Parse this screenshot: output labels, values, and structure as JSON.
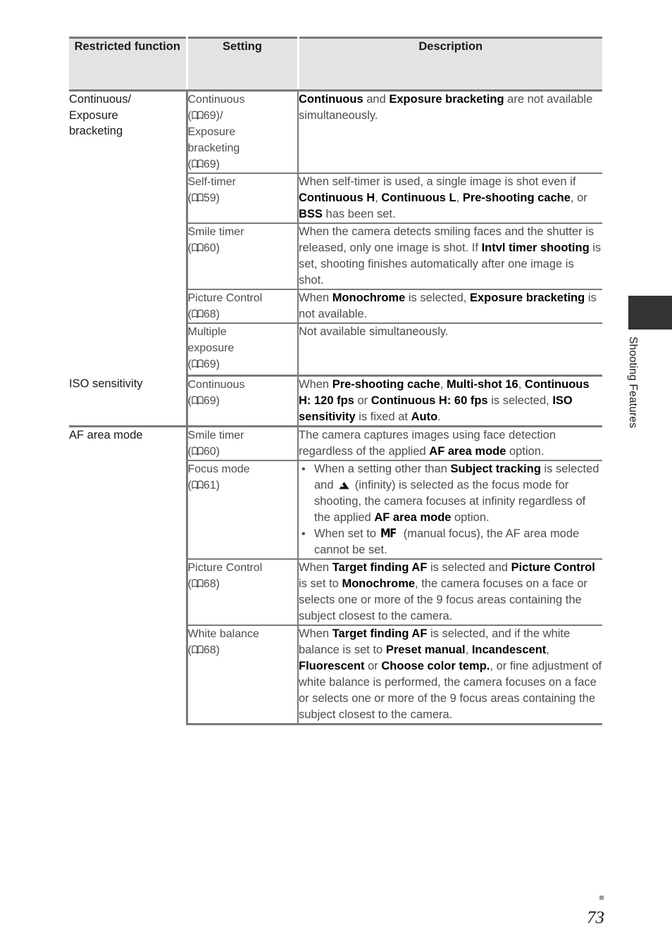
{
  "page": {
    "number": "73",
    "side_tab_label": "Shooting Features",
    "side_tab_color": "#333333"
  },
  "table": {
    "headers": {
      "restricted_function": "Restricted function",
      "setting": "Setting",
      "description": "Description"
    },
    "groups": [
      {
        "name": "Continuous/ Exposure bracketing",
        "rows": [
          {
            "setting_name": "Continuous",
            "setting_ref": "69",
            "setting_name2": "Exposure bracketing",
            "setting_ref2": "69",
            "setting_separator": "/",
            "description": "Continuous and Exposure bracketing are not available simultaneously."
          },
          {
            "setting_name": "Self-timer",
            "setting_ref": "59",
            "description": "When self-timer is used, a single image is shot even if Continuous H, Continuous L, Pre-shooting cache, or BSS has been set."
          },
          {
            "setting_name": "Smile timer",
            "setting_ref": "60",
            "description": "When the camera detects smiling faces and the shutter is released, only one image is shot. If Intvl timer shooting is set, shooting finishes automatically after one image is shot."
          },
          {
            "setting_name": "Picture Control",
            "setting_ref": "68",
            "description": "When Monochrome is selected, Exposure bracketing is not available."
          },
          {
            "setting_name": "Multiple exposure",
            "setting_ref": "69",
            "description": "Not available simultaneously."
          }
        ]
      },
      {
        "name": "ISO sensitivity",
        "rows": [
          {
            "setting_name": "Continuous",
            "setting_ref": "69",
            "description": "When Pre-shooting cache, Multi-shot 16, Continuous H: 120 fps or Continuous H: 60 fps is selected, ISO sensitivity is fixed at Auto."
          }
        ]
      },
      {
        "name": "AF area mode",
        "rows": [
          {
            "setting_name": "Smile timer",
            "setting_ref": "60",
            "description": "The camera captures images using face detection regardless of the applied AF area mode option."
          },
          {
            "setting_name": "Focus mode",
            "setting_ref": "61",
            "bullets": [
              "When a setting other than Subject tracking is selected and ▲ (infinity) is selected as the focus mode for shooting, the camera focuses at infinity regardless of the applied AF area mode option.",
              "When set to MF (manual focus), the AF area mode cannot be set."
            ]
          },
          {
            "setting_name": "Picture Control",
            "setting_ref": "68",
            "description": "When Target finding AF is selected and Picture Control is set to Monochrome, the camera focuses on a face or selects one or more of the 9 focus areas containing the subject closest to the camera."
          },
          {
            "setting_name": "White balance",
            "setting_ref": "68",
            "description": "When Target finding AF is selected, and if the white balance is set to Preset manual, Incandescent, Fluorescent or Choose color temp., or fine adjustment of white balance is performed, the camera focuses on a face or selects one or more of the 9 focus areas containing the subject closest to the camera."
          }
        ]
      }
    ],
    "rich_text": {
      "r0_setting": [
        {
          "t": "Continuous",
          "b": false
        },
        {
          "t": "\n(",
          "b": false
        },
        {
          "t": "BOOK",
          "b": false
        },
        {
          "t": "69)/",
          "b": false
        },
        {
          "t": "\nExposure",
          "b": false
        },
        {
          "t": "\nbracketing",
          "b": false
        },
        {
          "t": "\n(",
          "b": false
        },
        {
          "t": "BOOK",
          "b": false
        },
        {
          "t": "69)",
          "b": false
        }
      ]
    }
  }
}
